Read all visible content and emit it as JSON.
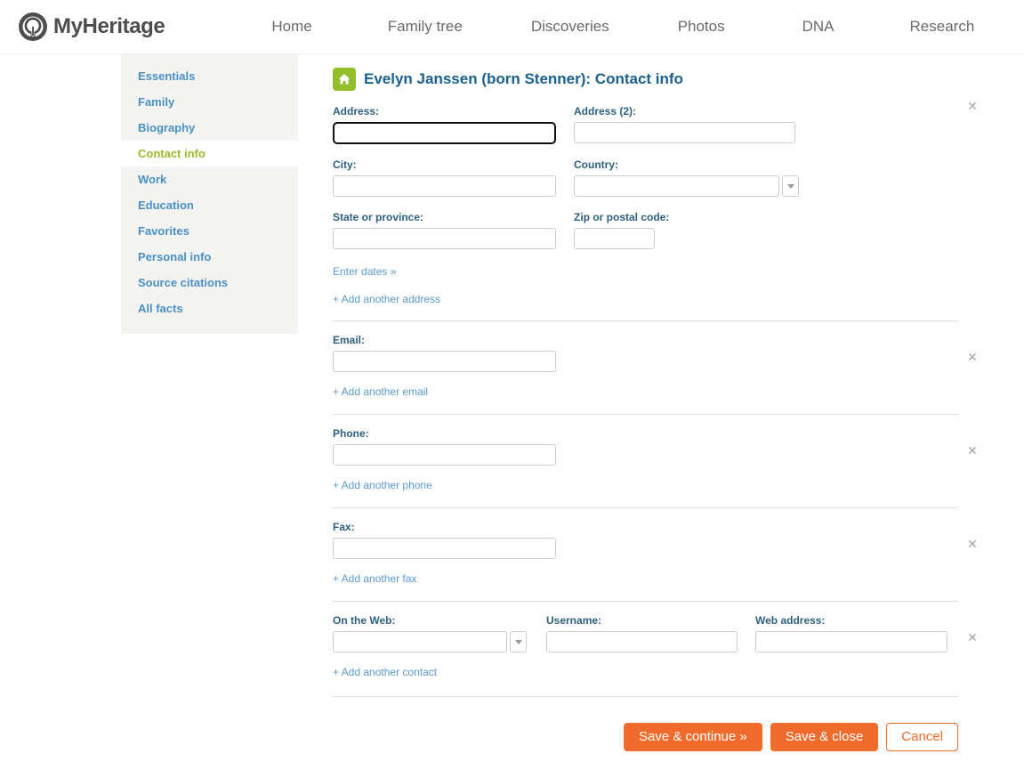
{
  "brand": {
    "name": "MyHeritage",
    "logo_icon": "myheritage-tree-logo"
  },
  "nav": [
    {
      "label": "Home"
    },
    {
      "label": "Family tree"
    },
    {
      "label": "Discoveries"
    },
    {
      "label": "Photos"
    },
    {
      "label": "DNA"
    },
    {
      "label": "Research"
    }
  ],
  "sidebar": {
    "items": [
      {
        "label": "Essentials",
        "active": false
      },
      {
        "label": "Family",
        "active": false
      },
      {
        "label": "Biography",
        "active": false
      },
      {
        "label": "Contact info",
        "active": true
      },
      {
        "label": "Work",
        "active": false
      },
      {
        "label": "Education",
        "active": false
      },
      {
        "label": "Favorites",
        "active": false
      },
      {
        "label": "Personal info",
        "active": false
      },
      {
        "label": "Source citations",
        "active": false
      },
      {
        "label": "All facts",
        "active": false
      }
    ]
  },
  "header": {
    "title": "Evelyn Janssen (born Stenner): Contact info",
    "icon": "house-icon"
  },
  "form": {
    "address": {
      "address_label": "Address:",
      "address_value": "",
      "address2_label": "Address (2):",
      "address2_value": "",
      "city_label": "City:",
      "city_value": "",
      "country_label": "Country:",
      "country_value": "",
      "state_label": "State or province:",
      "state_value": "",
      "zip_label": "Zip or postal code:",
      "zip_value": "",
      "enter_dates_link": "Enter dates »",
      "add_link": "+ Add another address"
    },
    "email": {
      "label": "Email:",
      "value": "",
      "add_link": "+ Add another email"
    },
    "phone": {
      "label": "Phone:",
      "value": "",
      "add_link": "+ Add another phone"
    },
    "fax": {
      "label": "Fax:",
      "value": "",
      "add_link": "+ Add another fax"
    },
    "web": {
      "type_label": "On the Web:",
      "type_value": "",
      "username_label": "Username:",
      "username_value": "",
      "webaddress_label": "Web address:",
      "webaddress_value": "",
      "add_link": "+ Add another contact"
    },
    "remove_icon": "✕"
  },
  "actions": {
    "save_continue": "Save & continue »",
    "save_close": "Save & close",
    "cancel": "Cancel"
  },
  "colors": {
    "accent_orange": "#ef6c2d",
    "link_blue": "#5b9bd1",
    "title_blue": "#1a6090",
    "active_green": "#9aba2a",
    "icon_green": "#92be2c"
  }
}
